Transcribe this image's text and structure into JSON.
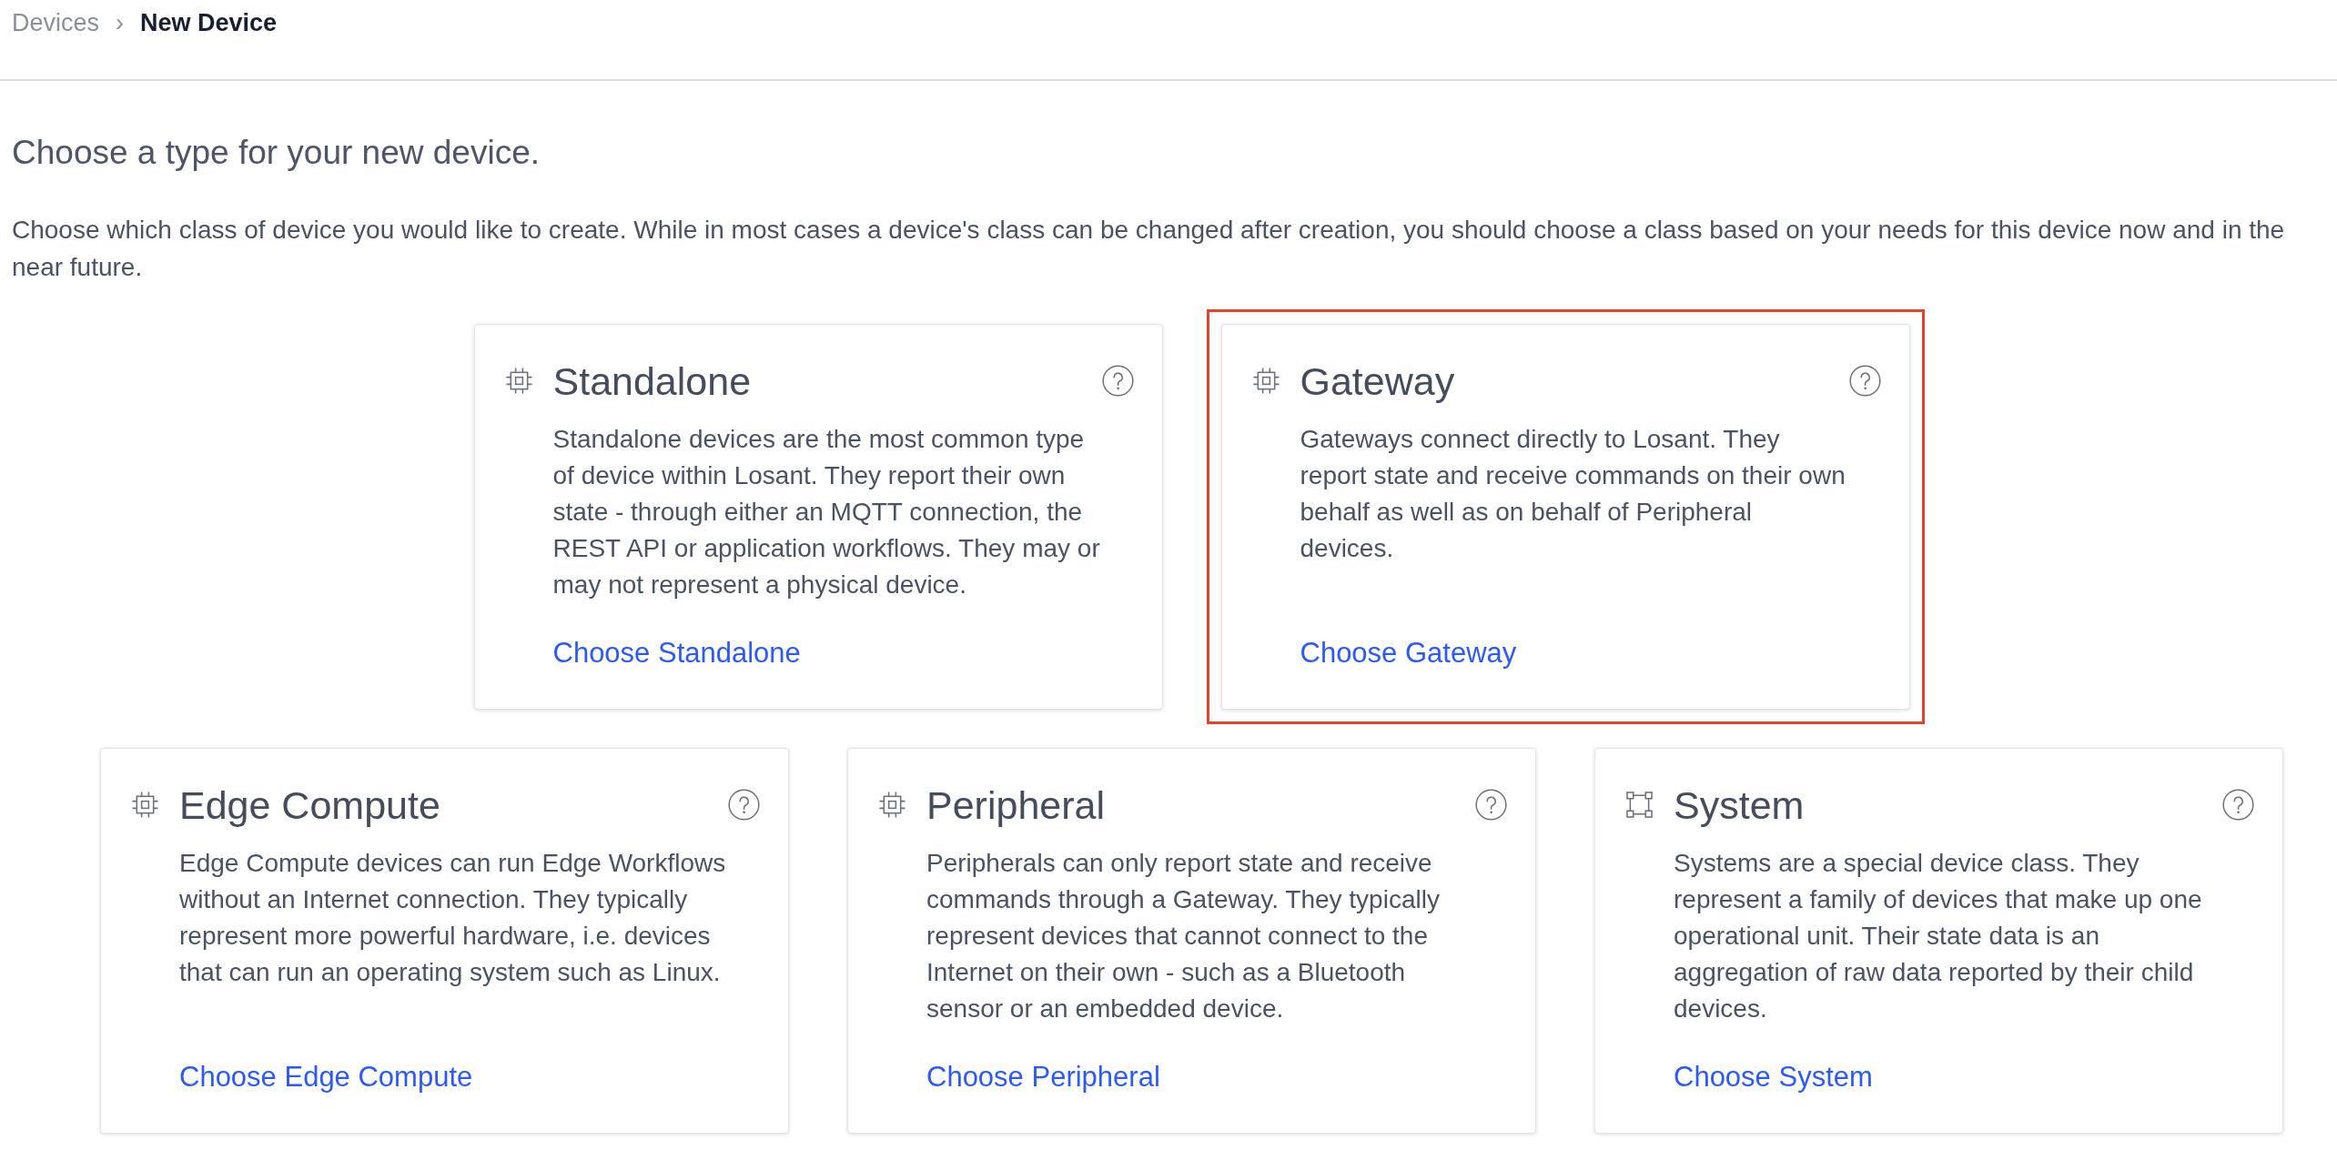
{
  "breadcrumb": {
    "items": [
      {
        "label": "Devices",
        "current": false
      },
      {
        "label": "New Device",
        "current": true
      }
    ],
    "separator": "›"
  },
  "heading": "Choose a type for your new device.",
  "intro": "Choose which class of device you would like to create. While in most cases a device's class can be changed after creation, you should choose a class based on your needs for this device now and in the near future.",
  "card_rows": [
    {
      "cards": [
        {
          "kind": "device",
          "title": "Standalone",
          "description": "Standalone devices are the most common type of device within Losant. They report their own state - through either an MQTT connection, the REST API or application workflows. They may or may not represent a physical device.",
          "link": "Choose Standalone",
          "highlighted": false
        },
        {
          "kind": "device",
          "title": "Gateway",
          "description": "Gateways connect directly to Losant. They report state and receive commands on their own behalf as well as on behalf of Peripheral devices.",
          "link": "Choose Gateway",
          "highlighted": true
        }
      ]
    },
    {
      "cards": [
        {
          "kind": "device",
          "title": "Edge Compute",
          "description": "Edge Compute devices can run Edge Workflows without an Internet connection. They typically represent more powerful hardware, i.e. devices that can run an operating system such as Linux.",
          "link": "Choose Edge Compute",
          "highlighted": false
        },
        {
          "kind": "device",
          "title": "Peripheral",
          "description": "Peripherals can only report state and receive commands through a Gateway. They typically represent devices that cannot connect to the Internet on their own - such as a Bluetooth sensor or an embedded device.",
          "link": "Choose Peripheral",
          "highlighted": false
        },
        {
          "kind": "system",
          "title": "System",
          "description": "Systems are a special device class. They represent a family of devices that make up one operational unit. Their state data is an aggregation of raw data reported by their child devices.",
          "link": "Choose System",
          "highlighted": false
        }
      ]
    }
  ]
}
